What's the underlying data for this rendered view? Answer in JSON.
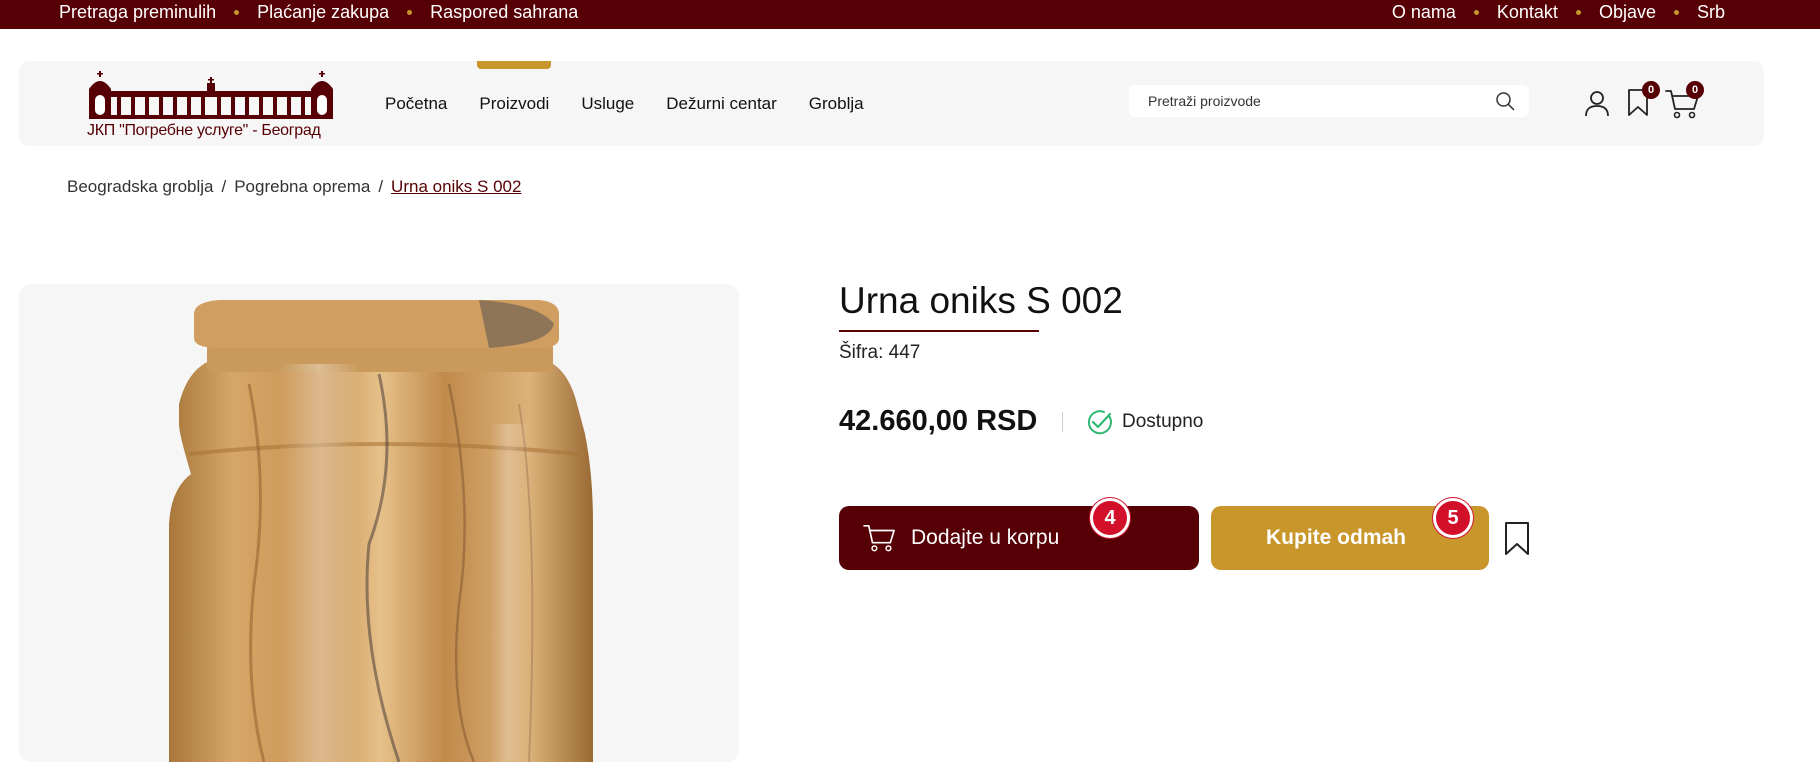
{
  "topbar": {
    "left_links": [
      "Pretraga preminulih",
      "Plaćanje zakupa",
      "Raspored sahrana"
    ],
    "right_links": [
      "O nama",
      "Kontakt",
      "Objave",
      "Srb"
    ]
  },
  "header": {
    "logo_text": "ЈКП \"Погребне услуге\" - Београд",
    "nav": [
      "Početna",
      "Proizvodi",
      "Usluge",
      "Dežurni centar",
      "Groblja"
    ],
    "active_nav": "Proizvodi",
    "search_placeholder": "Pretraži proizvode",
    "bookmark_count": "0",
    "cart_count": "0"
  },
  "breadcrumb": [
    "Beogradska groblja",
    "Pogrebna oprema",
    "Urna oniks S 002"
  ],
  "product": {
    "title": "Urna oniks S 002",
    "sku": "Šifra: 447",
    "price": "42.660,00 RSD",
    "availability": "Dostupno",
    "add_to_cart_label": "Dodajte u korpu",
    "buy_now_label": "Kupite odmah",
    "add_to_cart_marker": "4",
    "buy_now_marker": "5"
  },
  "colors": {
    "brand_dark": "#560005",
    "accent_gold": "#c8962a",
    "available_green": "#2eb872",
    "marker_red": "#d3102a"
  }
}
